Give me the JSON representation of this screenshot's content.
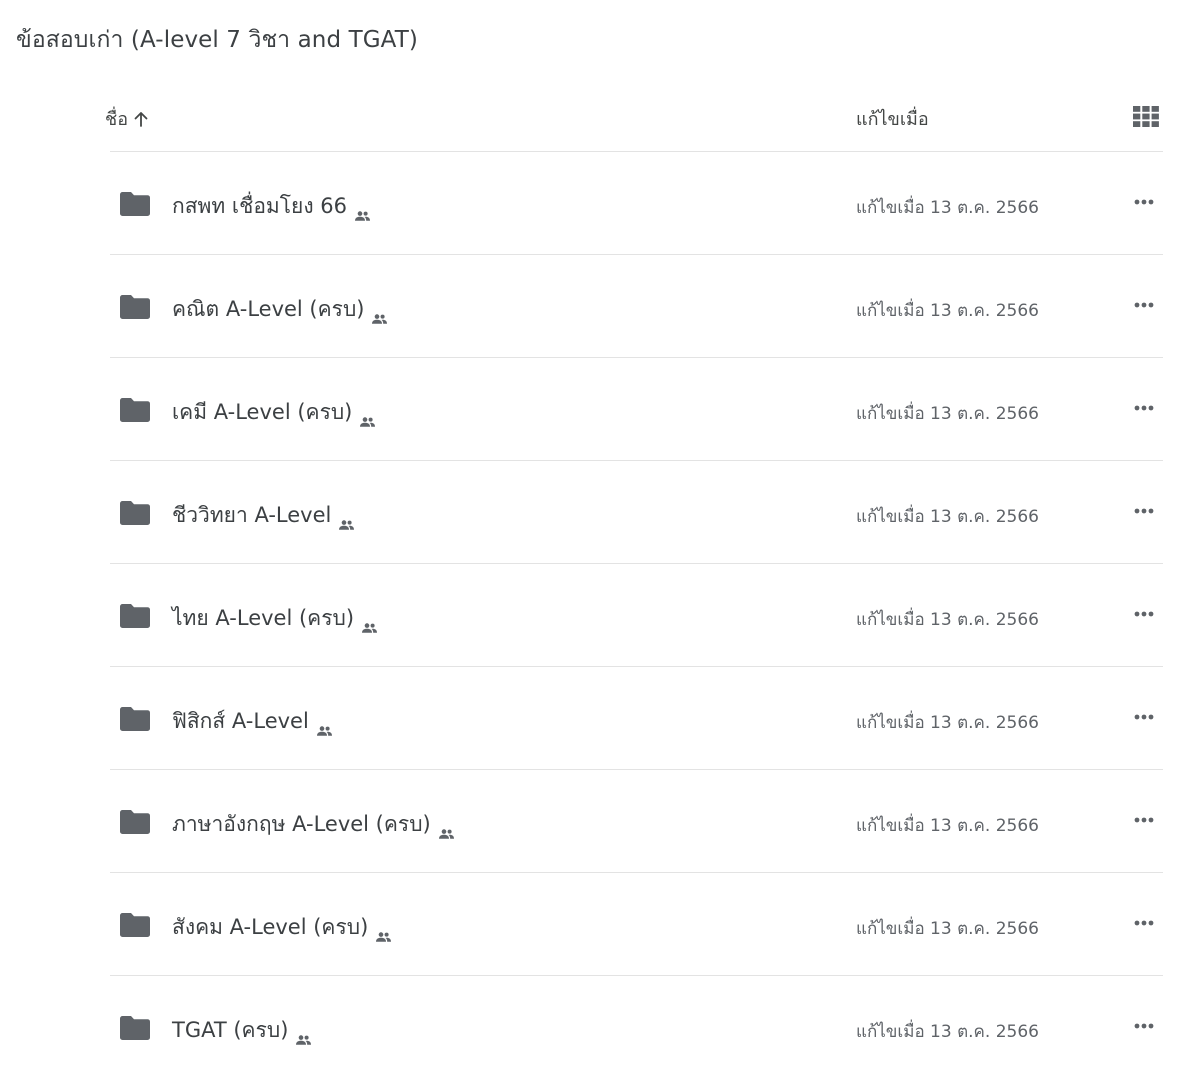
{
  "page_title": "ข้อสอบเก่า (A-level 7 วิชา and TGAT)",
  "header": {
    "name_label": "ชื่อ",
    "modified_label": "แก้ไขเมื่อ"
  },
  "icons": {
    "folder": "folder-icon",
    "shared": "shared-people-icon",
    "more": "more-horizontal-icon",
    "sort": "arrow-up-icon",
    "grid": "grid-view-icon"
  },
  "colors": {
    "folder": "#5f6368",
    "divider": "#e3e3e3",
    "text": "#3c4043"
  },
  "items": [
    {
      "name": "กสพท เชื่อมโยง 66",
      "modified": "แก้ไขเมื่อ 13 ต.ค. 2566"
    },
    {
      "name": "คณิต A-Level (ครบ)",
      "modified": "แก้ไขเมื่อ 13 ต.ค. 2566"
    },
    {
      "name": "เคมี A-Level (ครบ)",
      "modified": "แก้ไขเมื่อ 13 ต.ค. 2566"
    },
    {
      "name": "ชีววิทยา A-Level",
      "modified": "แก้ไขเมื่อ 13 ต.ค. 2566"
    },
    {
      "name": "ไทย A-Level (ครบ)",
      "modified": "แก้ไขเมื่อ 13 ต.ค. 2566"
    },
    {
      "name": "ฟิสิกส์ A-Level",
      "modified": "แก้ไขเมื่อ 13 ต.ค. 2566"
    },
    {
      "name": "ภาษาอังกฤษ A-Level (ครบ)",
      "modified": "แก้ไขเมื่อ 13 ต.ค. 2566"
    },
    {
      "name": "สังคม A-Level (ครบ)",
      "modified": "แก้ไขเมื่อ 13 ต.ค. 2566"
    },
    {
      "name": "TGAT (ครบ)",
      "modified": "แก้ไขเมื่อ 13 ต.ค. 2566"
    }
  ]
}
